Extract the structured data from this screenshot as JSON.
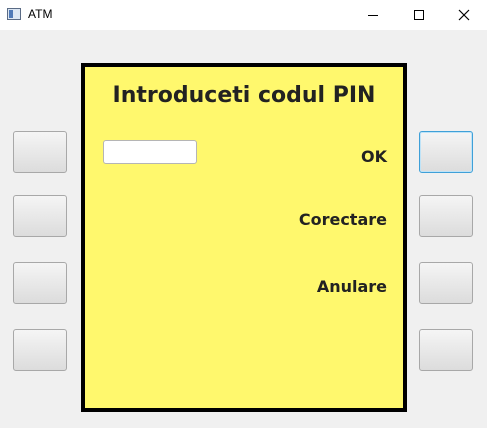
{
  "window": {
    "title": "ATM",
    "icon": "app-window-icon",
    "controls": [
      "minimize-icon",
      "maximize-icon",
      "close-icon"
    ]
  },
  "screen": {
    "title": "Introduceti codul PIN",
    "pin_value": "",
    "actions": {
      "ok": "OK",
      "correct": "Corectare",
      "cancel": "Anulare"
    },
    "background": "#fff86d"
  },
  "colors": {
    "screen_bg": "#fff86d",
    "focus_border": "#3fa0d8"
  }
}
